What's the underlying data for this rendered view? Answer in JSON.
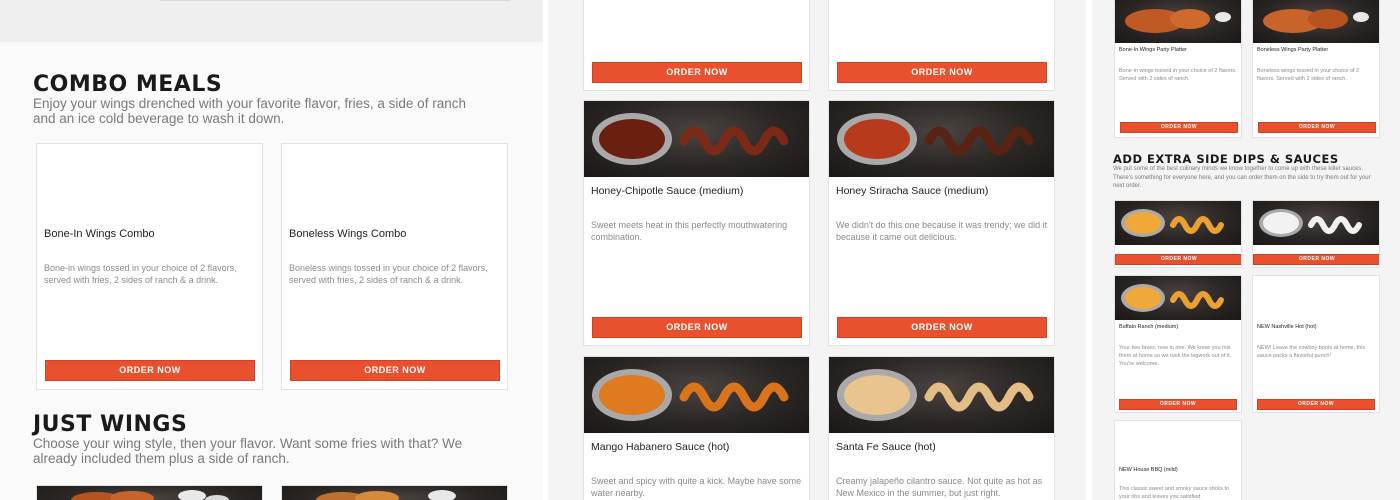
{
  "combo": {
    "title": "COMBO MEALS",
    "description": "Enjoy your wings drenched with your favorite flavor, fries, a side of ranch and an ice cold beverage to wash it down.",
    "items": [
      {
        "name": "Bone-In Wings Combo",
        "description": "Bone-in wings tossed in your choice of 2 flavors, served with fries, 2 sides of ranch & a drink.",
        "button": "ORDER NOW"
      },
      {
        "name": "Boneless Wings Combo",
        "description": "Boneless wings tossed in your choice of 2 flavors, served with fries, 2 sides of ranch & a drink.",
        "button": "ORDER NOW"
      }
    ]
  },
  "just_wings": {
    "title": "JUST WINGS",
    "description": "Choose your wing style, then your flavor. Want some fries with that? We already included them plus a side of ranch."
  },
  "sauces": {
    "top_buttons": [
      "ORDER NOW",
      "ORDER NOW"
    ],
    "items": [
      {
        "name": "Honey-Chipotle Sauce (medium)",
        "description": "Sweet meets heat in this perfectly mouthwatering combination.",
        "button": "ORDER NOW",
        "color": "#7a2a16"
      },
      {
        "name": "Honey Sriracha Sauce (medium)",
        "description": "We didn't do this one because it was trendy; we did it because it came out delicious.",
        "button": "ORDER NOW",
        "color": "#b83a1c"
      },
      {
        "name": "Mango Habanero Sauce (hot)",
        "description": "Sweet and spicy with quite a kick. Maybe have some water nearby.",
        "color": "#e07a20"
      },
      {
        "name": "Santa Fe Sauce (hot)",
        "description": "Creamy jalapeño cilantro sauce. Not quite as hot as New Mexico in the summer, but just right.",
        "color": "#e8c48e"
      }
    ]
  },
  "party": {
    "items": [
      {
        "name": "Bone-In Wings Party Platter",
        "description": "Bone-in wings tossed in your choice of 2 flavors. Served with 2 sides of ranch.",
        "button": "ORDER NOW"
      },
      {
        "name": "Boneless Wings Party Platter",
        "description": "Boneless wings tossed in your choice of 2 flavors. Served with 2 sides of ranch.",
        "button": "ORDER NOW"
      }
    ]
  },
  "extras": {
    "title": "ADD EXTRA SIDE DIPS & SAUCES",
    "description": "We put some of the best culinary minds we know together to come up with these killer sauces. There's something for everyone here, and you can order them on the side to try them out for your next order.",
    "top_buttons": [
      "ORDER NOW",
      "ORDER NOW"
    ],
    "items": [
      {
        "name": "Buffalo Ranch (medium)",
        "description": "Your two faves, now in one. We know you mix them at home so we took the legwork out of it. You're welcome.",
        "button": "ORDER NOW",
        "color": "#f0a838"
      },
      {
        "name": "NEW Nashville Hot (hot)",
        "description": "NEW! Leave the cowboy boots at home, this sauce packs a flavorful punch!",
        "button": "ORDER NOW"
      },
      {
        "name": "NEW House BBQ (mild)",
        "description": "This classic sweet and smoky sauce sticks to your ribs and leaves you satisfied."
      }
    ]
  },
  "colors": {
    "accent": "#e8502e",
    "text": "#222222",
    "muted": "#8a8a8a"
  }
}
